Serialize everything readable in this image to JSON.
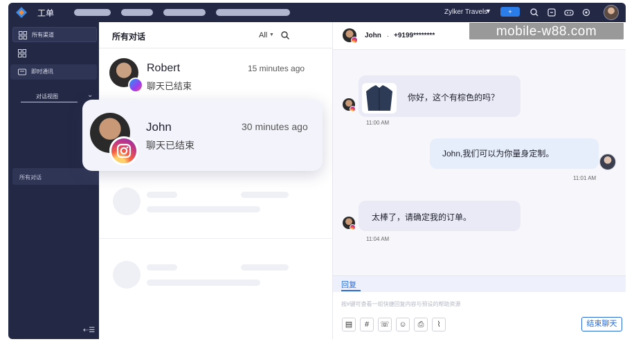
{
  "app": {
    "title": "工单",
    "org": "Zylker Travels",
    "new_label": "+"
  },
  "sidebar": {
    "items": [
      {
        "label": "所有渠道"
      },
      {
        "label": ""
      },
      {
        "label": "即时通讯"
      }
    ],
    "view_label": "对话视图",
    "all_conversations": "所有对话",
    "collapse": "⇠☰"
  },
  "list": {
    "title": "所有对话",
    "filter": "All",
    "conversations": [
      {
        "name": "Robert",
        "time": "15 minutes ago",
        "preview": "聊天已结束",
        "channel": "messenger"
      },
      {
        "name": "John",
        "time": "30 minutes ago",
        "preview": "聊天已结束",
        "channel": "instagram"
      }
    ]
  },
  "chat": {
    "contact_name": "John",
    "separator": ".",
    "phone": "+9199********",
    "watermark": "mobile-w88.com",
    "messages": [
      {
        "direction": "in",
        "text": "你好，这个有棕色的吗？",
        "time": "11:00 AM",
        "has_image": true
      },
      {
        "direction": "out",
        "text": "John,我们可以为你量身定制。",
        "time": "11:01 AM"
      },
      {
        "direction": "in",
        "text": "太棒了，请确定我的订单。",
        "time": "11:04 AM"
      }
    ],
    "reply_tab": "回复",
    "compose_placeholder": "按#键可查看一组快捷回复内容与预设的帮助资源",
    "tools": [
      "▤",
      "#",
      "☏",
      "☺",
      "⎙",
      "⌇"
    ],
    "end_button": "结束聊天"
  },
  "colors": {
    "sidebar_bg": "#232844",
    "accent": "#2b6bd8",
    "instagram": "#c13584",
    "messenger": "#2196f3"
  }
}
